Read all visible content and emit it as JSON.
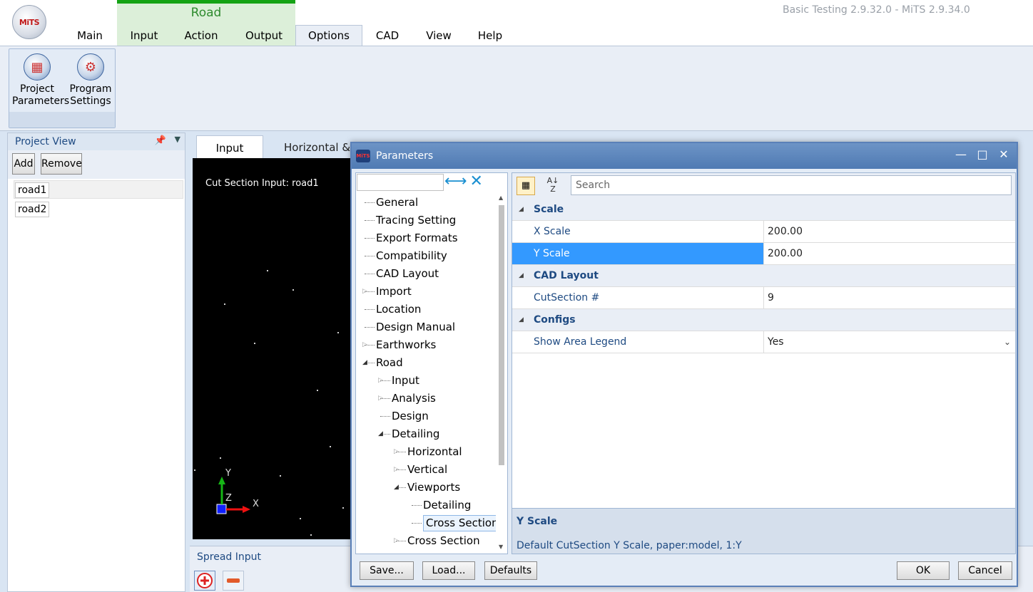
{
  "app": {
    "version": "Basic Testing 2.9.32.0 - MiTS 2.9.34.0",
    "logo_text": "MiTS"
  },
  "ribbon": {
    "context_group": "Road",
    "tabs": [
      "Main",
      "Input",
      "Action",
      "Output",
      "Options",
      "CAD",
      "View",
      "Help"
    ],
    "active_tab": "Options",
    "buttons": [
      {
        "label_line1": "Project",
        "label_line2": "Parameters"
      },
      {
        "label_line1": "Program",
        "label_line2": "Settings"
      }
    ]
  },
  "project_view": {
    "title": "Project View",
    "add_label": "Add",
    "remove_label": "Remove",
    "items": [
      "road1",
      "road2"
    ]
  },
  "doc": {
    "tabs": [
      "Input",
      "Horizontal & V"
    ],
    "cad_title": "Cut Section Input: road1",
    "axis_y": "Y",
    "axis_x": "X"
  },
  "spread": {
    "title": "Spread Input"
  },
  "dialog": {
    "title": "Parameters",
    "tree": [
      {
        "label": "General",
        "level": 0,
        "exp": ""
      },
      {
        "label": "Tracing Setting",
        "level": 0,
        "exp": ""
      },
      {
        "label": "Export Formats",
        "level": 0,
        "exp": ""
      },
      {
        "label": "Compatibility",
        "level": 0,
        "exp": ""
      },
      {
        "label": "CAD Layout",
        "level": 0,
        "exp": ""
      },
      {
        "label": "Import",
        "level": 0,
        "exp": "collapsed"
      },
      {
        "label": "Location",
        "level": 0,
        "exp": ""
      },
      {
        "label": "Design Manual",
        "level": 0,
        "exp": ""
      },
      {
        "label": "Earthworks",
        "level": 0,
        "exp": "collapsed"
      },
      {
        "label": "Road",
        "level": 0,
        "exp": "expanded"
      },
      {
        "label": "Input",
        "level": 1,
        "exp": "collapsed"
      },
      {
        "label": "Analysis",
        "level": 1,
        "exp": "collapsed"
      },
      {
        "label": "Design",
        "level": 1,
        "exp": ""
      },
      {
        "label": "Detailing",
        "level": 1,
        "exp": "expanded"
      },
      {
        "label": "Horizontal",
        "level": 2,
        "exp": "collapsed"
      },
      {
        "label": "Vertical",
        "level": 2,
        "exp": "collapsed"
      },
      {
        "label": "Viewports",
        "level": 2,
        "exp": "expanded"
      },
      {
        "label": "Detailing",
        "level": 3,
        "exp": ""
      },
      {
        "label": "Cross Section",
        "level": 3,
        "exp": "",
        "selected": true
      },
      {
        "label": "Cross Section",
        "level": 2,
        "exp": "collapsed"
      }
    ],
    "search_placeholder": "Search",
    "categories": [
      {
        "name": "Scale",
        "props": [
          {
            "name": "X Scale",
            "value": "200.00"
          },
          {
            "name": "Y Scale",
            "value": "200.00",
            "selected": true
          }
        ]
      },
      {
        "name": "CAD Layout",
        "props": [
          {
            "name": "CutSection #",
            "value": "9"
          }
        ]
      },
      {
        "name": "Configs",
        "props": [
          {
            "name": "Show Area Legend",
            "value": "Yes",
            "dropdown": true
          }
        ]
      }
    ],
    "description": {
      "title": "Y Scale",
      "text": "Default CutSection Y Scale, paper:model, 1:Y"
    },
    "buttons": {
      "save": "Save...",
      "load": "Load...",
      "defaults": "Defaults",
      "ok": "OK",
      "cancel": "Cancel"
    }
  }
}
